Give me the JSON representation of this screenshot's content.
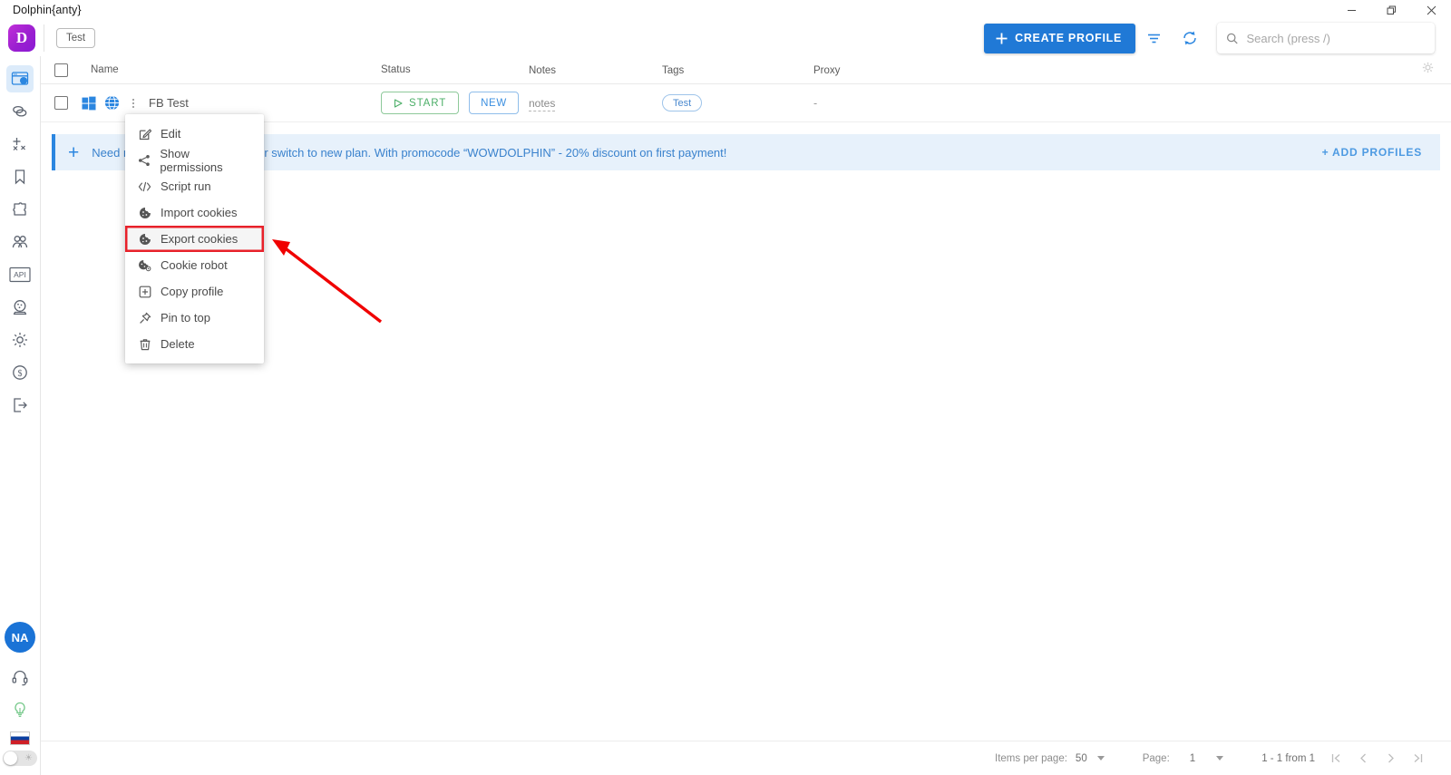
{
  "window": {
    "title": "Dolphin{anty}",
    "controls": [
      {
        "name": "minimize-button",
        "glyph": "minimize"
      },
      {
        "name": "restore-button",
        "glyph": "restore"
      },
      {
        "name": "close-button",
        "glyph": "close"
      }
    ]
  },
  "appbar": {
    "logo_letter": "D",
    "logo_color": "#a31fd4",
    "tab_label": "Test",
    "create_profile_label": "CREATE PROFILE",
    "create_profile_color": "#2079d6",
    "filter_icon": "filter-icon",
    "refresh_icon": "refresh-icon",
    "search": {
      "placeholder": "Search (press /)",
      "value": "",
      "icon": "search-icon"
    }
  },
  "sidebar": {
    "items": [
      {
        "name": "browser-profiles",
        "icon": "browser-window-icon",
        "active": true
      },
      {
        "name": "proxies",
        "icon": "rings-icon",
        "active": false
      },
      {
        "name": "extensions-clear",
        "icon": "clear-cookies-icon",
        "active": false
      },
      {
        "name": "bookmarks",
        "icon": "bookmark-icon",
        "active": false
      },
      {
        "name": "plugins",
        "icon": "puzzle-icon",
        "active": false
      },
      {
        "name": "team",
        "icon": "users-icon",
        "active": false
      },
      {
        "name": "api",
        "icon": "api-icon",
        "active": false
      },
      {
        "name": "automation",
        "icon": "crystal-ball-icon",
        "active": false
      },
      {
        "name": "settings",
        "icon": "gear-icon",
        "active": false
      },
      {
        "name": "billing",
        "icon": "dollar-circle-icon",
        "active": false
      },
      {
        "name": "logout",
        "icon": "logout-icon",
        "active": false
      }
    ],
    "avatar_initials": "NA",
    "avatar_color": "#1a73d6",
    "support_icon": "headset-icon",
    "tips_icon": "lightbulb-icon",
    "language_flag": "ru-flag-icon",
    "theme_toggle": "theme-toggle"
  },
  "table": {
    "columns": [
      {
        "key": "name",
        "label": "Name"
      },
      {
        "key": "status",
        "label": "Status"
      },
      {
        "key": "notes",
        "label": "Notes"
      },
      {
        "key": "tags",
        "label": "Tags"
      },
      {
        "key": "proxy",
        "label": "Proxy"
      }
    ],
    "settings_icon": "gear-icon",
    "rows": [
      {
        "os_icon": "windows-icon",
        "browser_icon": "globe-icon",
        "menu_icon": "kebab-menu-icon",
        "name": "FB Test",
        "start_label": "START",
        "status_badge": "NEW",
        "notes": "notes",
        "tag": "Test",
        "proxy": "-"
      }
    ]
  },
  "banner": {
    "plus_icon": "plus-icon",
    "text": "Need more profiles? Add them, or switch to new plan. With promocode “WOWDOLPHIN” - 20% discount on first payment!",
    "link_label": "+ ADD PROFILES"
  },
  "context_menu": {
    "items": [
      {
        "label": "Edit",
        "icon": "edit-icon",
        "highlighted": false
      },
      {
        "label": "Show permissions",
        "icon": "share-icon",
        "highlighted": false
      },
      {
        "label": "Script run",
        "icon": "code-icon",
        "highlighted": false
      },
      {
        "label": "Import cookies",
        "icon": "cookie-icon",
        "highlighted": false
      },
      {
        "label": "Export cookies",
        "icon": "cookie-icon",
        "highlighted": true
      },
      {
        "label": "Cookie robot",
        "icon": "cookie-robot-icon",
        "highlighted": false
      },
      {
        "label": "Copy profile",
        "icon": "copy-icon",
        "highlighted": false
      },
      {
        "label": "Pin to top",
        "icon": "pin-icon",
        "highlighted": false
      },
      {
        "label": "Delete",
        "icon": "trash-icon",
        "highlighted": false
      }
    ],
    "highlight_color": "#e8212a"
  },
  "annotation": {
    "color": "#f00000",
    "arrow": "red-arrow-pointer"
  },
  "footer": {
    "items_per_page_label": "Items per page:",
    "items_per_page_value": "50",
    "page_label": "Page:",
    "page_value": "1",
    "range_label": "1 - 1 from 1",
    "nav": [
      "first-page",
      "prev-page",
      "next-page",
      "last-page"
    ]
  }
}
